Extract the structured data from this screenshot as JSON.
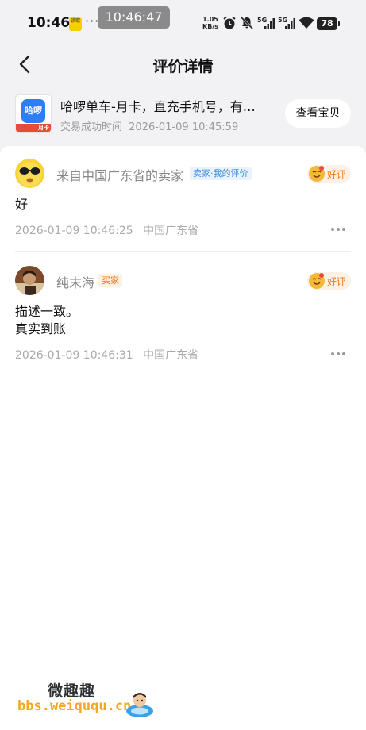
{
  "status_bar": {
    "time": "10:46",
    "tag": "读取",
    "dots": "···",
    "pill_time": "10:46:47",
    "net_speed_value": "1.05",
    "net_speed_unit": "KB/s",
    "signal_label": "5G",
    "battery": "78"
  },
  "header": {
    "title": "评价详情"
  },
  "product": {
    "thumb_logo_text": "哈啰",
    "thumb_strip_text": "月卡",
    "title": "哈啰单车-月卡，直充手机号，有…",
    "meta_label": "交易成功时间",
    "meta_time": "2026-01-09 10:45:59",
    "view_button": "查看宝贝"
  },
  "reviews": [
    {
      "name": "来自中国广东省的卖家",
      "badge": "卖家·我的评价",
      "rating": "好评",
      "text_lines": [
        "好"
      ],
      "time": "2026-01-09 10:46:25",
      "location": "中国广东省"
    },
    {
      "name": "纯末海",
      "badge": "买家",
      "rating": "好评",
      "text_lines": [
        "描述一致。",
        "真实到账"
      ],
      "time": "2026-01-09 10:46:31",
      "location": "中国广东省"
    }
  ],
  "watermark": {
    "title": "微趣趣",
    "url": "bbs.weiququ.cn"
  },
  "colors": {
    "background_top": "#f2f2f4",
    "badge_blue": "#3b8ee0",
    "badge_orange": "#e57a1f",
    "rating_bg": "#fdf1e6",
    "watermark_orange": "#f6a623"
  },
  "icons": [
    "back-arrow-icon",
    "alarm-icon",
    "mute-icon",
    "signal-icon",
    "wifi-icon",
    "battery-icon",
    "emoji-face-icon",
    "more-dots-icon"
  ]
}
